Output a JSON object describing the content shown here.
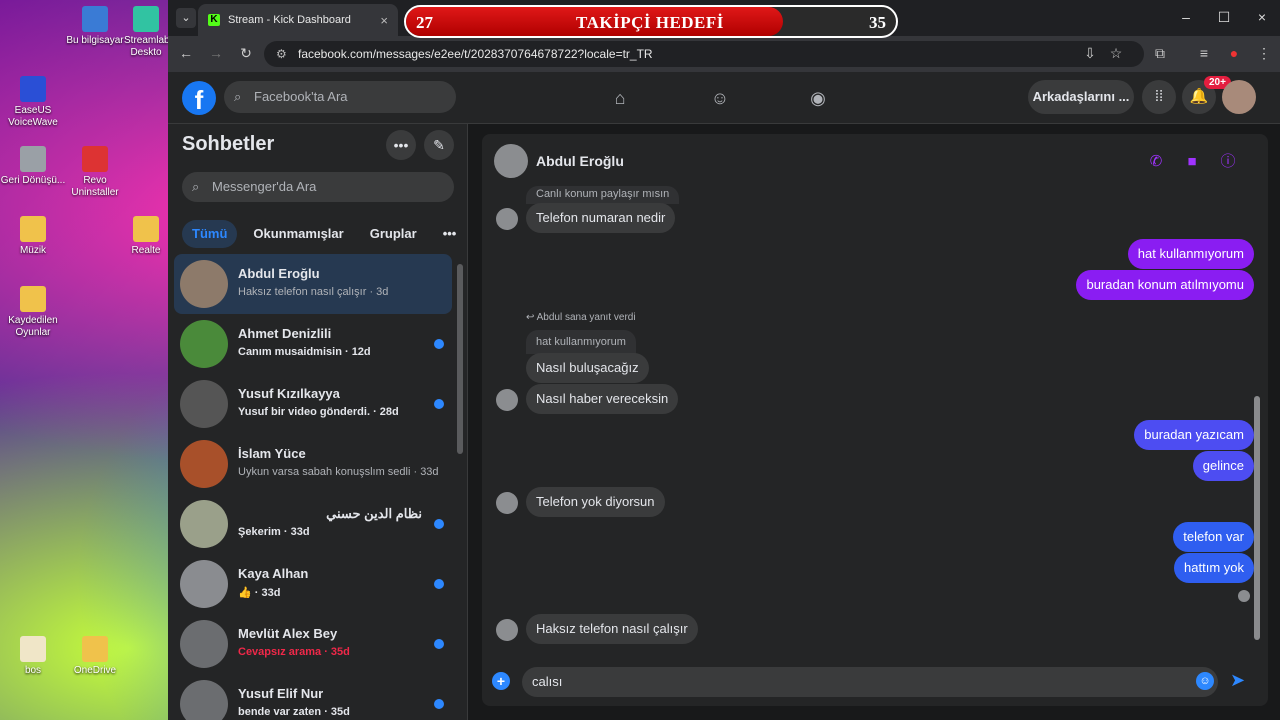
{
  "desktop": {
    "icons": [
      {
        "label": "Bu bilgisayar",
        "color": "#3a7bd5"
      },
      {
        "label": "Streamlabs Deskto",
        "color": "#31c3a2"
      },
      {
        "label": "EaseUS VoiceWave",
        "color": "#2a4fd6"
      },
      {
        "label": "Geri Dönüşü...",
        "color": "#9aa0a6"
      },
      {
        "label": "Revo Uninstaller",
        "color": "#d33"
      },
      {
        "label": "Müzik",
        "color": "#f0c24b"
      },
      {
        "label": "Realte",
        "color": "#f0c24b"
      },
      {
        "label": "Kaydedilen Oyunlar",
        "color": "#f0c24b"
      },
      {
        "label": "bos",
        "color": "#f0e6c8"
      },
      {
        "label": "OneDrive",
        "color": "#f0c24b"
      }
    ]
  },
  "browser": {
    "tab_title": "Stream - Kick Dashboard",
    "url": "facebook.com/messages/e2ee/t/2028370764678722?locale=tr_TR"
  },
  "overlay": {
    "current": "27",
    "title": "TAKİPÇİ HEDEFİ",
    "goal": "35",
    "progress": 0.77
  },
  "header": {
    "search_placeholder": "Facebook'ta Ara",
    "friends_label": "Arkadaşlarını ...",
    "notification_badge": "20+"
  },
  "sidebar": {
    "title": "Sohbetler",
    "search_placeholder": "Messenger'da Ara",
    "filters": [
      "Tümü",
      "Okunmamışlar",
      "Gruplar"
    ],
    "conversations": [
      {
        "name": "Abdul Eroğlu",
        "snippet": "Haksız telefon nasıl çalışır · 3d",
        "unread": false,
        "active": true,
        "avatar_color": "#8d7a6a"
      },
      {
        "name": "Ahmet Denizlili",
        "snippet": "Canım musaidmisin · 12d",
        "unread": true,
        "active": false,
        "avatar_color": "#4a8a3a"
      },
      {
        "name": "Yusuf Kızılkayya",
        "snippet": "Yusuf bir video gönderdi. · 28d",
        "unread": true,
        "active": false,
        "avatar_color": "#555555"
      },
      {
        "name": "İslam Yüce",
        "snippet": "Uykun varsa sabah konuşslım sedli · 33d",
        "unread": false,
        "active": false,
        "avatar_color": "#a8502a"
      },
      {
        "name": "نظام الدين حسني",
        "snippet": "Şekerim · 33d",
        "unread": true,
        "active": false,
        "avatar_color": "#9aa08a",
        "rtl": true
      },
      {
        "name": "Kaya Alhan",
        "snippet": "👍 · 33d",
        "unread": true,
        "active": false,
        "avatar_color": "#8a8c90"
      },
      {
        "name": "Mevlüt Alex Bey",
        "snippet": "Cevapsız arama · 35d",
        "unread": true,
        "active": false,
        "missed": true,
        "avatar_color": "#6b6d70"
      },
      {
        "name": "Yusuf Elif Nur",
        "snippet": "bende var zaten · 35d",
        "unread": true,
        "active": false,
        "avatar_color": "#6b6d70"
      }
    ]
  },
  "chat": {
    "contact_name": "Abdul Eroğlu",
    "quoted_top": "Canlı konum paylaşır mısın",
    "reply_note": "Abdul sana yanıt verdi",
    "quoted_reply": "hat kullanmıyorum",
    "messages": [
      {
        "dir": "in",
        "text": "Telefon numaran nedir"
      },
      {
        "dir": "out",
        "text": "hat kullanmıyorum",
        "color": "#8a1df2"
      },
      {
        "dir": "out",
        "text": "buradan konum atılmıyomu",
        "color": "#8a1df2"
      },
      {
        "dir": "in",
        "text": "Nasıl  buluşacağız"
      },
      {
        "dir": "in",
        "text": "Nasıl haber vereceksin"
      },
      {
        "dir": "out",
        "text": "buradan yazıcam",
        "color": "#4d4df2"
      },
      {
        "dir": "out",
        "text": "gelince",
        "color": "#4d4df2"
      },
      {
        "dir": "in",
        "text": "Telefon yok diyorsun"
      },
      {
        "dir": "out",
        "text": "telefon var",
        "color": "#2f5ef0"
      },
      {
        "dir": "out",
        "text": "hattım yok",
        "color": "#2f5ef0"
      },
      {
        "dir": "in",
        "text": "Haksız telefon nasıl çalışır"
      }
    ],
    "composer_text": "calısı"
  }
}
